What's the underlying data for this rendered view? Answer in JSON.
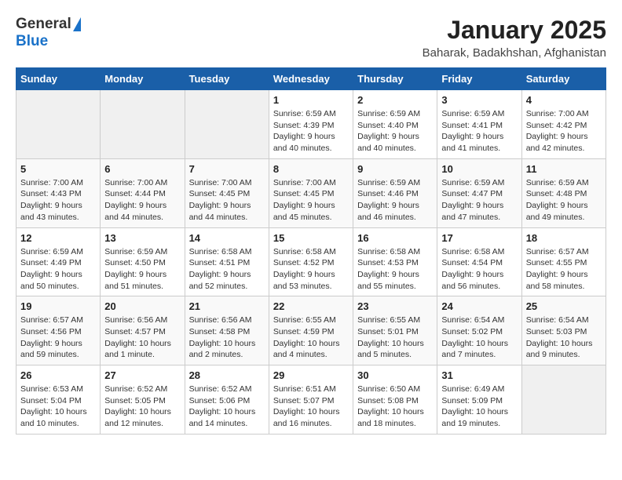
{
  "header": {
    "logo_general": "General",
    "logo_blue": "Blue",
    "main_title": "January 2025",
    "sub_title": "Baharak, Badakhshan, Afghanistan"
  },
  "days_of_week": [
    "Sunday",
    "Monday",
    "Tuesday",
    "Wednesday",
    "Thursday",
    "Friday",
    "Saturday"
  ],
  "weeks": [
    [
      {
        "day": "",
        "info": ""
      },
      {
        "day": "",
        "info": ""
      },
      {
        "day": "",
        "info": ""
      },
      {
        "day": "1",
        "info": "Sunrise: 6:59 AM\nSunset: 4:39 PM\nDaylight: 9 hours\nand 40 minutes."
      },
      {
        "day": "2",
        "info": "Sunrise: 6:59 AM\nSunset: 4:40 PM\nDaylight: 9 hours\nand 40 minutes."
      },
      {
        "day": "3",
        "info": "Sunrise: 6:59 AM\nSunset: 4:41 PM\nDaylight: 9 hours\nand 41 minutes."
      },
      {
        "day": "4",
        "info": "Sunrise: 7:00 AM\nSunset: 4:42 PM\nDaylight: 9 hours\nand 42 minutes."
      }
    ],
    [
      {
        "day": "5",
        "info": "Sunrise: 7:00 AM\nSunset: 4:43 PM\nDaylight: 9 hours\nand 43 minutes."
      },
      {
        "day": "6",
        "info": "Sunrise: 7:00 AM\nSunset: 4:44 PM\nDaylight: 9 hours\nand 44 minutes."
      },
      {
        "day": "7",
        "info": "Sunrise: 7:00 AM\nSunset: 4:45 PM\nDaylight: 9 hours\nand 44 minutes."
      },
      {
        "day": "8",
        "info": "Sunrise: 7:00 AM\nSunset: 4:45 PM\nDaylight: 9 hours\nand 45 minutes."
      },
      {
        "day": "9",
        "info": "Sunrise: 6:59 AM\nSunset: 4:46 PM\nDaylight: 9 hours\nand 46 minutes."
      },
      {
        "day": "10",
        "info": "Sunrise: 6:59 AM\nSunset: 4:47 PM\nDaylight: 9 hours\nand 47 minutes."
      },
      {
        "day": "11",
        "info": "Sunrise: 6:59 AM\nSunset: 4:48 PM\nDaylight: 9 hours\nand 49 minutes."
      }
    ],
    [
      {
        "day": "12",
        "info": "Sunrise: 6:59 AM\nSunset: 4:49 PM\nDaylight: 9 hours\nand 50 minutes."
      },
      {
        "day": "13",
        "info": "Sunrise: 6:59 AM\nSunset: 4:50 PM\nDaylight: 9 hours\nand 51 minutes."
      },
      {
        "day": "14",
        "info": "Sunrise: 6:58 AM\nSunset: 4:51 PM\nDaylight: 9 hours\nand 52 minutes."
      },
      {
        "day": "15",
        "info": "Sunrise: 6:58 AM\nSunset: 4:52 PM\nDaylight: 9 hours\nand 53 minutes."
      },
      {
        "day": "16",
        "info": "Sunrise: 6:58 AM\nSunset: 4:53 PM\nDaylight: 9 hours\nand 55 minutes."
      },
      {
        "day": "17",
        "info": "Sunrise: 6:58 AM\nSunset: 4:54 PM\nDaylight: 9 hours\nand 56 minutes."
      },
      {
        "day": "18",
        "info": "Sunrise: 6:57 AM\nSunset: 4:55 PM\nDaylight: 9 hours\nand 58 minutes."
      }
    ],
    [
      {
        "day": "19",
        "info": "Sunrise: 6:57 AM\nSunset: 4:56 PM\nDaylight: 9 hours\nand 59 minutes."
      },
      {
        "day": "20",
        "info": "Sunrise: 6:56 AM\nSunset: 4:57 PM\nDaylight: 10 hours\nand 1 minute."
      },
      {
        "day": "21",
        "info": "Sunrise: 6:56 AM\nSunset: 4:58 PM\nDaylight: 10 hours\nand 2 minutes."
      },
      {
        "day": "22",
        "info": "Sunrise: 6:55 AM\nSunset: 4:59 PM\nDaylight: 10 hours\nand 4 minutes."
      },
      {
        "day": "23",
        "info": "Sunrise: 6:55 AM\nSunset: 5:01 PM\nDaylight: 10 hours\nand 5 minutes."
      },
      {
        "day": "24",
        "info": "Sunrise: 6:54 AM\nSunset: 5:02 PM\nDaylight: 10 hours\nand 7 minutes."
      },
      {
        "day": "25",
        "info": "Sunrise: 6:54 AM\nSunset: 5:03 PM\nDaylight: 10 hours\nand 9 minutes."
      }
    ],
    [
      {
        "day": "26",
        "info": "Sunrise: 6:53 AM\nSunset: 5:04 PM\nDaylight: 10 hours\nand 10 minutes."
      },
      {
        "day": "27",
        "info": "Sunrise: 6:52 AM\nSunset: 5:05 PM\nDaylight: 10 hours\nand 12 minutes."
      },
      {
        "day": "28",
        "info": "Sunrise: 6:52 AM\nSunset: 5:06 PM\nDaylight: 10 hours\nand 14 minutes."
      },
      {
        "day": "29",
        "info": "Sunrise: 6:51 AM\nSunset: 5:07 PM\nDaylight: 10 hours\nand 16 minutes."
      },
      {
        "day": "30",
        "info": "Sunrise: 6:50 AM\nSunset: 5:08 PM\nDaylight: 10 hours\nand 18 minutes."
      },
      {
        "day": "31",
        "info": "Sunrise: 6:49 AM\nSunset: 5:09 PM\nDaylight: 10 hours\nand 19 minutes."
      },
      {
        "day": "",
        "info": ""
      }
    ]
  ]
}
